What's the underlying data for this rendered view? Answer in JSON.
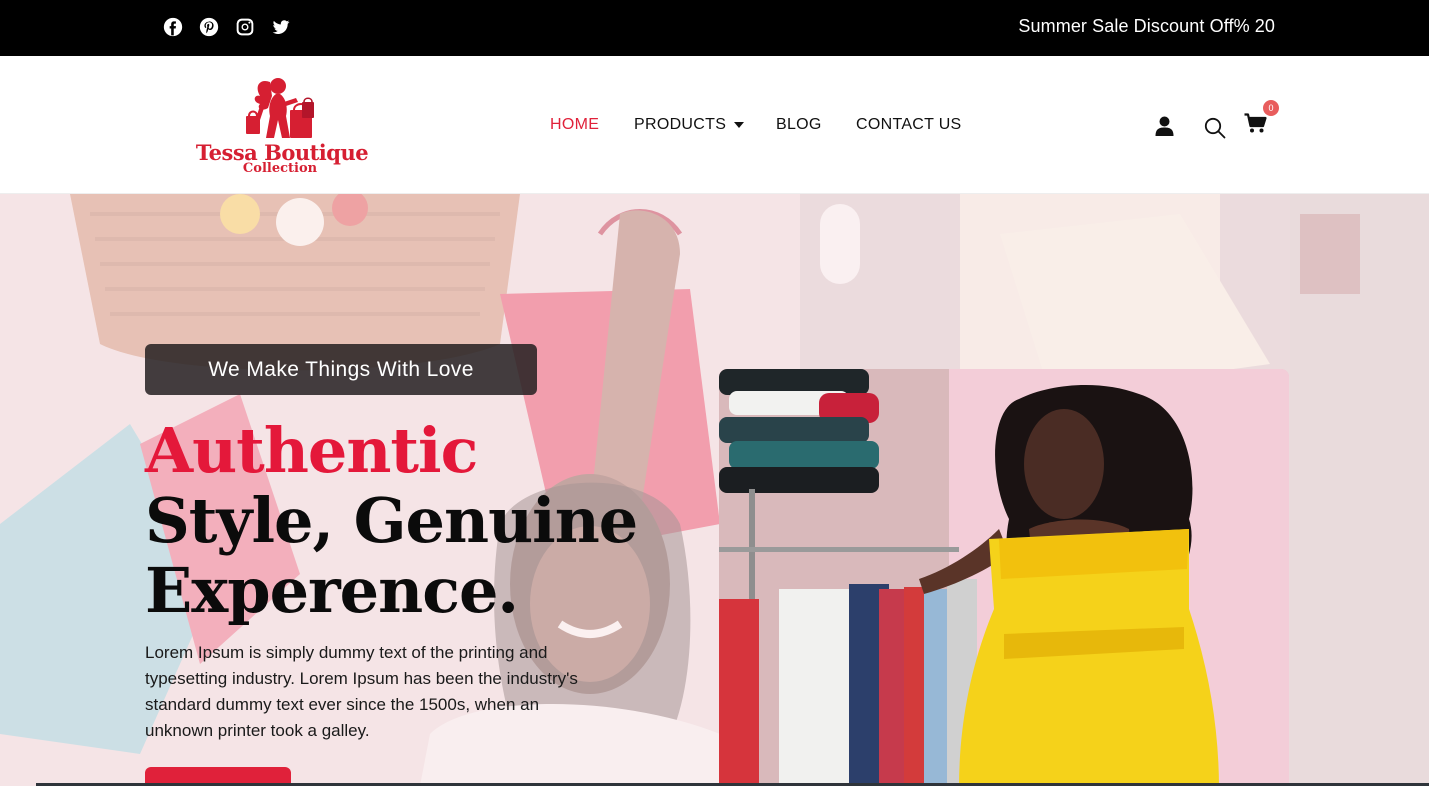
{
  "topbar": {
    "social": [
      {
        "name": "facebook-icon"
      },
      {
        "name": "pinterest-icon"
      },
      {
        "name": "instagram-icon"
      },
      {
        "name": "twitter-icon"
      }
    ],
    "promo": "Summer Sale Discount Off% 20"
  },
  "header": {
    "logo": {
      "line1": "Tessa Boutique",
      "line2": "Collection"
    },
    "nav": [
      {
        "label": "HOME",
        "active": true
      },
      {
        "label": "PRODUCTS",
        "has_dropdown": true
      },
      {
        "label": "BLOG"
      },
      {
        "label": "CONTACT US"
      }
    ],
    "icons": [
      "user-icon",
      "search-icon",
      "cart-icon"
    ],
    "cart_count": "0"
  },
  "hero": {
    "tagline": "We Make Things With Love",
    "headline_red": "Authentic",
    "headline_line2": "Style, Genuine",
    "headline_line3": "Experence.",
    "body": "Lorem Ipsum is simply dummy text of the printing and typesetting industry. Lorem Ipsum has been the industry's standard dummy text ever since the 1500s, when an unknown printer took a galley."
  },
  "colors": {
    "accent": "#e0213a",
    "topbar_bg": "#000000",
    "cart_badge": "#e85d5d"
  }
}
